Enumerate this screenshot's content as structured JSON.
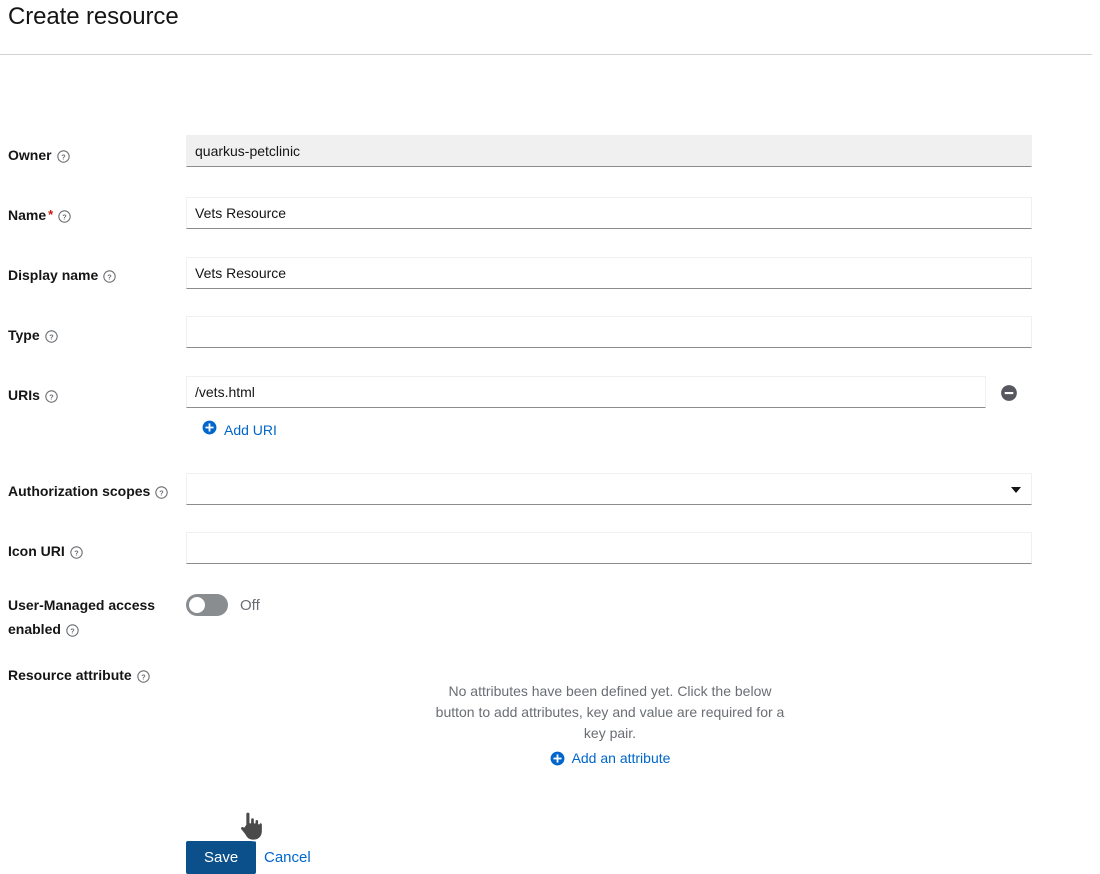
{
  "header": {
    "title": "Create resource"
  },
  "form": {
    "owner": {
      "label": "Owner",
      "help_icon": "question-circle-icon",
      "value": "quarkus-petclinic",
      "disabled": true
    },
    "name": {
      "label": "Name",
      "required_marker": "*",
      "help_icon": "question-circle-icon",
      "value": "Vets Resource"
    },
    "display_name": {
      "label": "Display name",
      "help_icon": "question-circle-icon",
      "value": "Vets Resource"
    },
    "type": {
      "label": "Type",
      "help_icon": "question-circle-icon",
      "value": ""
    },
    "uris": {
      "label": "URIs",
      "help_icon": "question-circle-icon",
      "value": "/vets.html",
      "remove_icon": "minus-circle-icon",
      "add_label": "Add URI",
      "add_icon": "plus-circle-icon"
    },
    "authorization_scopes": {
      "label": "Authorization scopes",
      "help_icon": "question-circle-icon",
      "value": "",
      "caret_icon": "chevron-down-icon"
    },
    "icon_uri": {
      "label": "Icon URI",
      "help_icon": "question-circle-icon",
      "value": ""
    },
    "user_managed_access": {
      "label": "User-Managed access enabled",
      "help_icon": "question-circle-icon",
      "state": "Off",
      "enabled": false
    },
    "resource_attribute": {
      "label": "Resource attribute",
      "help_icon": "question-circle-icon",
      "empty_text": "No attributes have been defined yet. Click the below button to add attributes, key and value are required for a key pair.",
      "add_label": "Add an attribute",
      "add_icon": "plus-circle-icon"
    }
  },
  "actions": {
    "save_label": "Save",
    "cancel_label": "Cancel"
  },
  "colors": {
    "primary_button": "#0b4f8b",
    "link": "#06c",
    "required": "#c9190b",
    "switch_off": "#8a8d90",
    "disabled_bg": "#f0f0f0"
  }
}
